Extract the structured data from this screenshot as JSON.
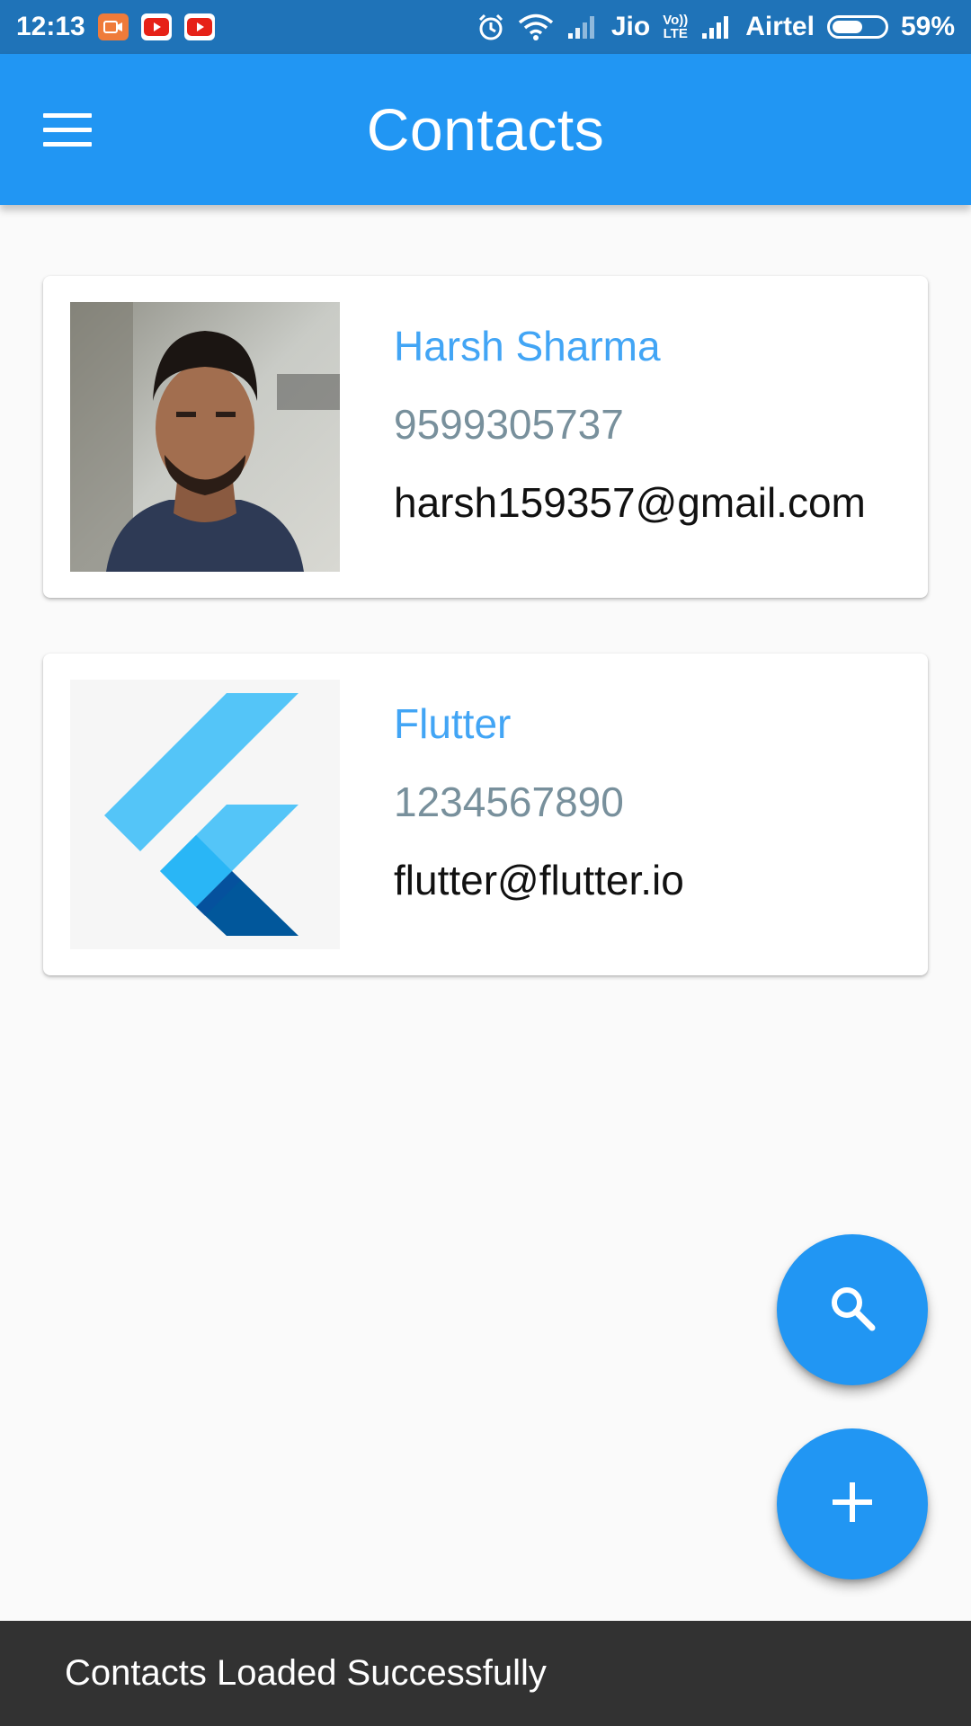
{
  "status_bar": {
    "time": "12:13",
    "carrier1": "Jio",
    "volte_line1": "Vo))",
    "volte_line2": "LTE",
    "carrier2": "Airtel",
    "battery": "59%",
    "battery_level": 0.59,
    "icons": [
      "screen-recorder-icon",
      "youtube-icon",
      "youtube-icon",
      "alarm-icon",
      "wifi-icon",
      "signal-icon",
      "signal-icon",
      "battery-icon"
    ]
  },
  "app_bar": {
    "title": "Contacts",
    "menu_icon": "menu-icon"
  },
  "contacts": [
    {
      "name": "Harsh Sharma",
      "phone": "9599305737",
      "email": "harsh159357@gmail.com",
      "avatar": "person-photo"
    },
    {
      "name": "Flutter",
      "phone": "1234567890",
      "email": "flutter@flutter.io",
      "avatar": "flutter-logo"
    }
  ],
  "fabs": {
    "search_icon": "search-icon",
    "add_icon": "add-icon"
  },
  "snackbar": {
    "message": "Contacts Loaded Successfully"
  },
  "colors": {
    "primary": "#2196f3",
    "status_bar": "#1f73b8",
    "name_text": "#42a5f5",
    "phone_text": "#78909c",
    "snackbar_bg": "#323232"
  }
}
